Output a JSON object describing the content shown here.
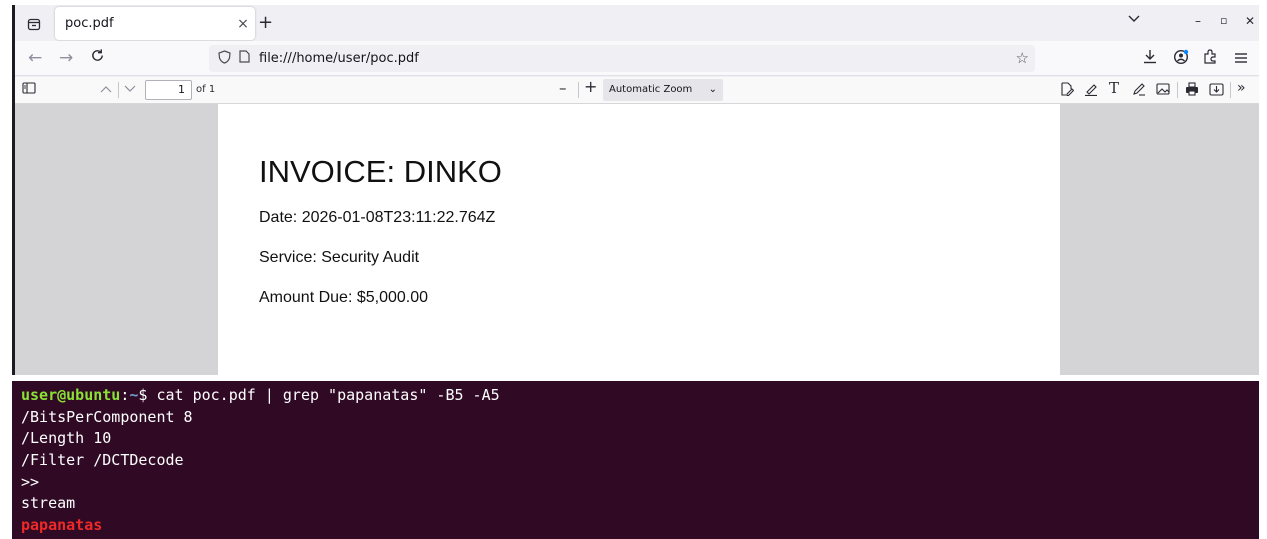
{
  "browser": {
    "tab": {
      "title": "poc.pdf",
      "close": "×"
    },
    "new_tab": "+",
    "url": "file:///home/user/poc.pdf",
    "window_controls": {
      "minimize": "–",
      "restore": "▫",
      "close": "✕"
    }
  },
  "pdf_toolbar": {
    "page_number": "1",
    "page_count": "of 1",
    "zoom_out": "–",
    "zoom_in": "+",
    "zoom_value": "Automatic Zoom"
  },
  "document": {
    "title": "INVOICE: DINKO",
    "date": "Date: 2026-01-08T23:11:22.764Z",
    "service": "Service: Security Audit",
    "amount": "Amount Due: $5,000.00"
  },
  "terminal": {
    "prompt_user": "user@ubuntu",
    "prompt_sep": ":",
    "prompt_path": "~",
    "prompt_symbol": "$ ",
    "command": "cat poc.pdf | grep \"papanatas\" -B5 -A5",
    "output": [
      "/BitsPerComponent 8",
      "/Length 10",
      "/Filter /DCTDecode",
      ">>",
      "stream"
    ],
    "match": "papanatas"
  },
  "colors": {
    "terminal_bg": "#300a24",
    "prompt_user": "#8ae234",
    "prompt_path": "#729fcf",
    "match": "#ef2929"
  }
}
